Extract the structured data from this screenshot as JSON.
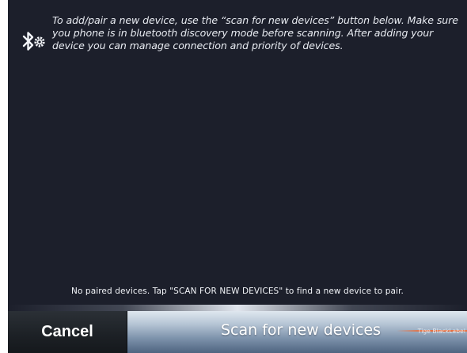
{
  "info": {
    "icon": "bluetooth-settings-icon",
    "instructions": "To add/pair a new device, use the “scan for new devices” button below. Make sure you phone is in bluetooth discovery mode before scanning. After adding your device you can manage connection and priority of devices."
  },
  "status": {
    "empty_message": "No paired devices. Tap \"SCAN FOR NEW DEVICES\" to find a new device to pair."
  },
  "buttons": {
    "cancel_label": "Cancel",
    "scan_label": "Scan for new devices"
  },
  "brand": {
    "text": "Tige BlackLabel"
  },
  "colors": {
    "background": "#1c1f2b",
    "accent": "#e87040",
    "text": "#ffffff"
  }
}
